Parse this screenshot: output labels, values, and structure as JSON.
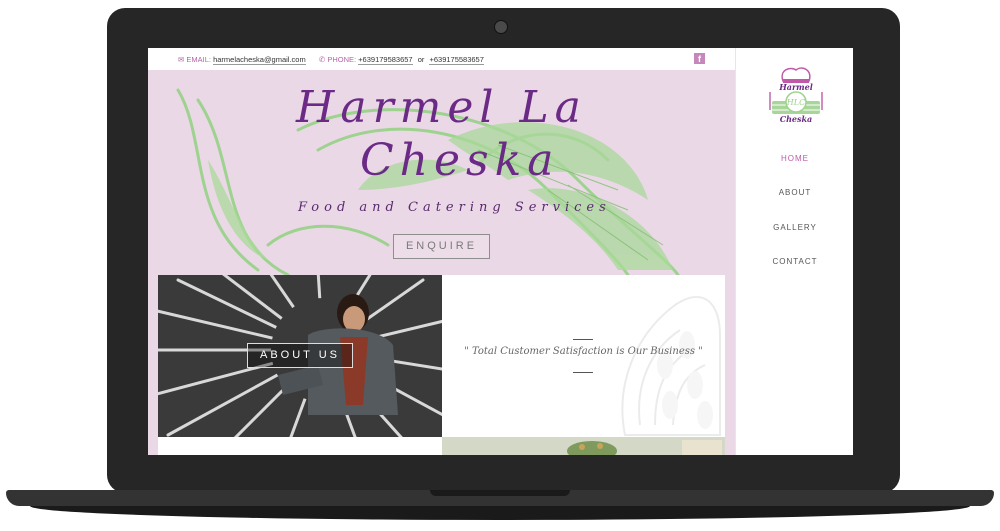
{
  "topbar": {
    "email_label": "EMAIL:",
    "email_value": "harmelacheska@gmail.com",
    "phone_label": "PHONE:",
    "phone_value_1": "+639179583657",
    "phone_or": "or",
    "phone_value_2": "+639175583657",
    "social_icon": "facebook-icon"
  },
  "hero": {
    "title_line1": "Harmel La",
    "title_line2": "Cheska",
    "tagline": "Food and Catering Services",
    "enquire_label": "ENQUIRE"
  },
  "about": {
    "button_label": "ABOUT US"
  },
  "quote": {
    "text": "\" Total Customer Satisfaction is Our Business \""
  },
  "logo": {
    "line1": "Harmel",
    "monogram": "HLC",
    "line2": "Cheska"
  },
  "nav": {
    "items": [
      {
        "label": "HOME",
        "active": true
      },
      {
        "label": "ABOUT",
        "active": false
      },
      {
        "label": "GALLERY",
        "active": false
      },
      {
        "label": "CONTACT",
        "active": false
      }
    ]
  },
  "colors": {
    "accent": "#c05aa8",
    "title": "#6b2a86",
    "hero_bg": "#ead8e6",
    "leaf": "#9ed28f"
  }
}
